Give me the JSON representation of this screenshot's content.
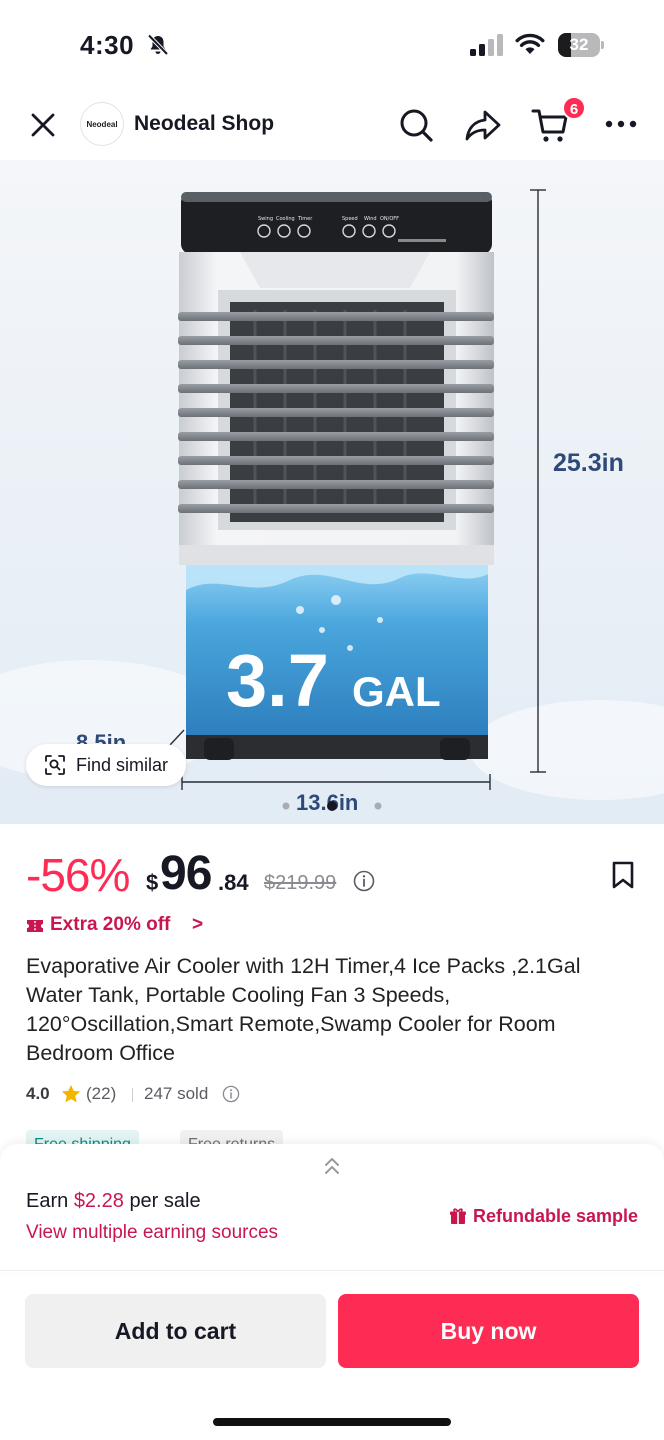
{
  "status_bar": {
    "time": "4:30",
    "battery": "32",
    "battery_level": 0.32
  },
  "header": {
    "shop_logo_text": "Neodeal",
    "shop_name": "Neodeal Shop",
    "cart_count": "6"
  },
  "hero": {
    "image_labels": {
      "height": "25.3in",
      "width": "13.6in",
      "depth": "8.5in",
      "capacity_number": "3.7",
      "capacity_unit": "GAL",
      "control_labels": [
        "Swing",
        "Cooling",
        "Timer",
        "Speed",
        "Wind",
        "ON/OFF"
      ]
    },
    "find_similar_label": "Find similar",
    "image_index": 2,
    "image_count": 3
  },
  "price": {
    "discount": "-56%",
    "currency": "$",
    "main": "96",
    "cents": ".84",
    "original": "$219.99"
  },
  "coupon": {
    "label": "Extra 20% off",
    "arrow": ">"
  },
  "product": {
    "title": "Evaporative Air Cooler with 12H Timer,4 Ice Packs ,2.1Gal Water Tank, Portable Cooling Fan 3 Speeds, 120°Oscillation,Smart Remote,Swamp Cooler for Room Bedroom Office"
  },
  "rating": {
    "value": "4.0",
    "count": "(22)",
    "sold": "247 sold"
  },
  "tags": {
    "shipping": "Free shipping",
    "returns": "Free returns"
  },
  "earn_panel": {
    "earn_prefix": "Earn",
    "earn_amount": "$2.28",
    "earn_suffix": "per sale",
    "link": "View multiple earning sources",
    "refundable": "Refundable sample"
  },
  "actions": {
    "add_to_cart": "Add to cart",
    "buy_now": "Buy now"
  },
  "colors": {
    "brand": "#fe2c55",
    "accent_text": "#c8174f",
    "shipping_tag": "#0f8c85",
    "star": "#f5b400",
    "water": "#4aa6dd"
  }
}
